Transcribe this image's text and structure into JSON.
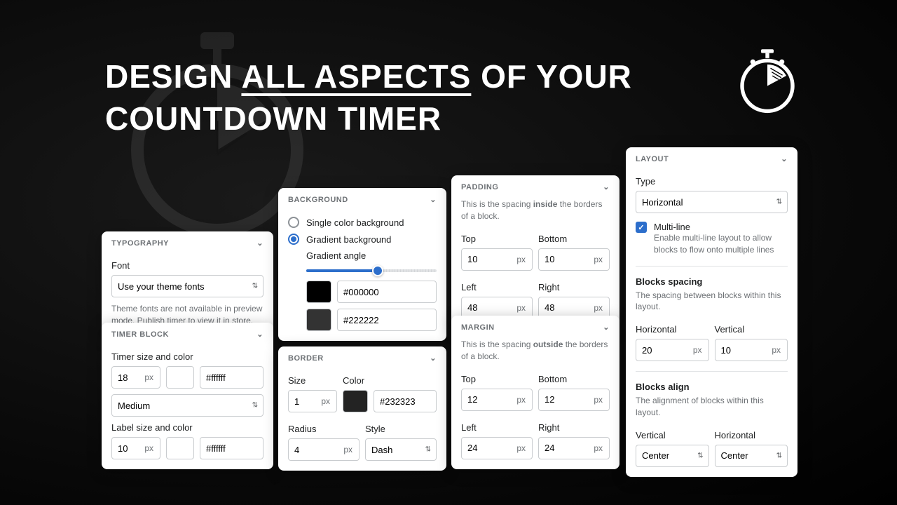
{
  "hero": {
    "line1a": "DESIGN ",
    "line1b": "ALL ASPECTS",
    "line1c": " OF YOUR",
    "line2": "COUNTDOWN TIMER"
  },
  "typography": {
    "header": "TYPOGRAPHY",
    "font_label": "Font",
    "font_value": "Use your theme fonts",
    "help": "Theme fonts are not available in preview mode. Publish timer to view it in store."
  },
  "timer_block": {
    "header": "TIMER BLOCK",
    "size_color_label": "Timer size and color",
    "size_value": "18",
    "size_unit": "px",
    "color_value": "#ffffff",
    "weight_value": "Medium",
    "label_size_color_label": "Label size and color",
    "label_size_value": "10",
    "label_size_unit": "px",
    "label_color_value": "#ffffff"
  },
  "background": {
    "header": "BACKGROUND",
    "single_label": "Single color background",
    "gradient_label": "Gradient background",
    "angle_label": "Gradient angle",
    "swatch1": "#000000",
    "color1": "#000000",
    "swatch2": "#222222",
    "color2": "#222222"
  },
  "border": {
    "header": "BORDER",
    "size_label": "Size",
    "size_value": "1",
    "size_unit": "px",
    "color_label": "Color",
    "swatch": "#232323",
    "color_value": "#232323",
    "radius_label": "Radius",
    "radius_value": "4",
    "radius_unit": "px",
    "style_label": "Style",
    "style_value": "Dash"
  },
  "padding": {
    "header": "PADDING",
    "help_a": "This is the spacing ",
    "help_b": "inside",
    "help_c": " the borders of a block.",
    "top_label": "Top",
    "top_value": "10",
    "bottom_label": "Bottom",
    "bottom_value": "10",
    "left_label": "Left",
    "left_value": "48",
    "right_label": "Right",
    "right_value": "48",
    "unit": "px"
  },
  "margin": {
    "header": "MARGIN",
    "help_a": "This is the spacing ",
    "help_b": "outside",
    "help_c": " the borders of a block.",
    "top_label": "Top",
    "top_value": "12",
    "bottom_label": "Bottom",
    "bottom_value": "12",
    "left_label": "Left",
    "left_value": "24",
    "right_label": "Right",
    "right_value": "24",
    "unit": "px"
  },
  "layout": {
    "header": "LAYOUT",
    "type_label": "Type",
    "type_value": "Horizontal",
    "multiline_label": "Multi-line",
    "multiline_help": "Enable multi-line layout to allow blocks to flow onto multiple lines",
    "spacing_title": "Blocks spacing",
    "spacing_help": "The spacing between blocks within this layout.",
    "h_label": "Horizontal",
    "h_value": "20",
    "v_label": "Vertical",
    "v_value": "10",
    "unit": "px",
    "align_title": "Blocks align",
    "align_help": "The alignment of blocks within this layout.",
    "align_v_label": "Vertical",
    "align_v_value": "Center",
    "align_h_label": "Horizontal",
    "align_h_value": "Center"
  }
}
